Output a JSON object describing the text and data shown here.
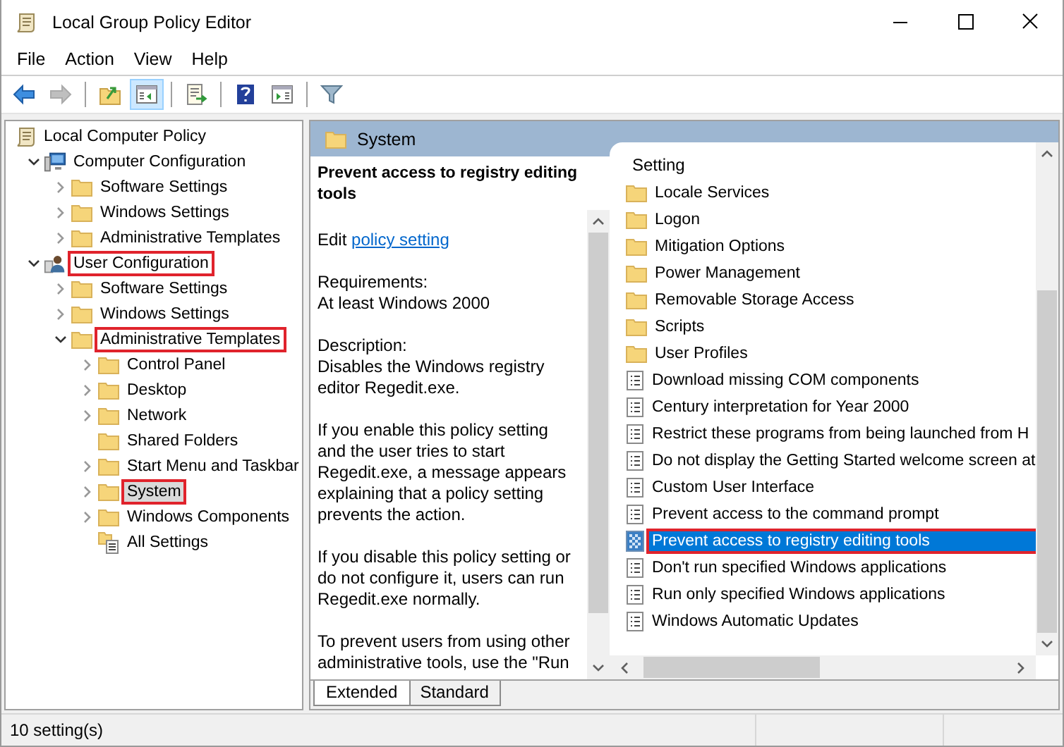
{
  "window": {
    "title": "Local Group Policy Editor"
  },
  "menu": [
    "File",
    "Action",
    "View",
    "Help"
  ],
  "toolbar": [
    {
      "pressed": false,
      "disabled": false
    },
    {
      "pressed": false,
      "disabled": true
    },
    {
      "pressed": false,
      "disabled": false
    },
    {
      "pressed": true,
      "disabled": false
    },
    {
      "pressed": false,
      "disabled": false
    },
    {
      "pressed": false,
      "disabled": false
    },
    {
      "pressed": false,
      "disabled": false
    },
    {
      "pressed": false,
      "disabled": false
    }
  ],
  "tree": [
    {
      "label": "Local Computer Policy",
      "kind": "policy",
      "expandable": false,
      "selected": false,
      "highlighted": false,
      "children": [
        {
          "label": "Computer Configuration",
          "kind": "computer",
          "expandable": true,
          "expanded": true,
          "selected": false,
          "highlighted": false,
          "children": [
            {
              "label": "Software Settings",
              "kind": "folder",
              "expandable": true,
              "expanded": false,
              "selected": false,
              "highlighted": false
            },
            {
              "label": "Windows Settings",
              "kind": "folder",
              "expandable": true,
              "expanded": false,
              "selected": false,
              "highlighted": false
            },
            {
              "label": "Administrative Templates",
              "kind": "folder",
              "expandable": true,
              "expanded": false,
              "selected": false,
              "highlighted": false
            }
          ]
        },
        {
          "label": "User Configuration",
          "kind": "user",
          "expandable": true,
          "expanded": true,
          "selected": false,
          "highlighted": true,
          "children": [
            {
              "label": "Software Settings",
              "kind": "folder",
              "expandable": true,
              "expanded": false,
              "selected": false,
              "highlighted": false
            },
            {
              "label": "Windows Settings",
              "kind": "folder",
              "expandable": true,
              "expanded": false,
              "selected": false,
              "highlighted": false
            },
            {
              "label": "Administrative Templates",
              "kind": "folder",
              "expandable": true,
              "expanded": true,
              "selected": false,
              "highlighted": true,
              "children": [
                {
                  "label": "Control Panel",
                  "kind": "folder",
                  "expandable": true,
                  "expanded": false,
                  "selected": false,
                  "highlighted": false
                },
                {
                  "label": "Desktop",
                  "kind": "folder",
                  "expandable": true,
                  "expanded": false,
                  "selected": false,
                  "highlighted": false
                },
                {
                  "label": "Network",
                  "kind": "folder",
                  "expandable": true,
                  "expanded": false,
                  "selected": false,
                  "highlighted": false
                },
                {
                  "label": "Shared Folders",
                  "kind": "folder",
                  "expandable": false,
                  "expanded": false,
                  "selected": false,
                  "highlighted": false
                },
                {
                  "label": "Start Menu and Taskbar",
                  "kind": "folder",
                  "expandable": true,
                  "expanded": false,
                  "selected": false,
                  "highlighted": false
                },
                {
                  "label": "System",
                  "kind": "folder",
                  "expandable": true,
                  "expanded": false,
                  "selected": true,
                  "highlighted": true
                },
                {
                  "label": "Windows Components",
                  "kind": "folder",
                  "expandable": true,
                  "expanded": false,
                  "selected": false,
                  "highlighted": false
                },
                {
                  "label": "All Settings",
                  "kind": "all-settings",
                  "expandable": false,
                  "expanded": false,
                  "selected": false,
                  "highlighted": false
                }
              ]
            }
          ]
        }
      ]
    }
  ],
  "details": {
    "header": "System",
    "title": "Prevent access to registry editing\ntools",
    "edit_prefix": "Edit",
    "edit_link": "policy setting",
    "paragraphs": [
      "Requirements:\nAt least Windows 2000",
      "Description:\nDisables the Windows registry\neditor Regedit.exe.",
      "If you enable this policy setting\nand the user tries to start\nRegedit.exe, a message appears\nexplaining that a policy setting\nprevents the action.",
      "If you disable this policy setting or\ndo not configure it, users can run\nRegedit.exe normally.",
      "To prevent users from using other\nadministrative tools, use the \"Run"
    ]
  },
  "settings": {
    "column": "Setting",
    "items": [
      {
        "label": "Locale Services",
        "kind": "folder",
        "selected": false,
        "highlighted": false
      },
      {
        "label": "Logon",
        "kind": "folder",
        "selected": false,
        "highlighted": false
      },
      {
        "label": "Mitigation Options",
        "kind": "folder",
        "selected": false,
        "highlighted": false
      },
      {
        "label": "Power Management",
        "kind": "folder",
        "selected": false,
        "highlighted": false
      },
      {
        "label": "Removable Storage Access",
        "kind": "folder",
        "selected": false,
        "highlighted": false
      },
      {
        "label": "Scripts",
        "kind": "folder",
        "selected": false,
        "highlighted": false
      },
      {
        "label": "User Profiles",
        "kind": "folder",
        "selected": false,
        "highlighted": false
      },
      {
        "label": "Download missing COM components",
        "kind": "policy",
        "selected": false,
        "highlighted": false
      },
      {
        "label": "Century interpretation for Year 2000",
        "kind": "policy",
        "selected": false,
        "highlighted": false
      },
      {
        "label": "Restrict these programs from being launched from H",
        "kind": "policy",
        "selected": false,
        "highlighted": false
      },
      {
        "label": "Do not display the Getting Started welcome screen at",
        "kind": "policy",
        "selected": false,
        "highlighted": false
      },
      {
        "label": "Custom User Interface",
        "kind": "policy",
        "selected": false,
        "highlighted": false
      },
      {
        "label": "Prevent access to the command prompt",
        "kind": "policy",
        "selected": false,
        "highlighted": false
      },
      {
        "label": "Prevent access to registry editing tools",
        "kind": "policy",
        "selected": true,
        "highlighted": true
      },
      {
        "label": "Don't run specified Windows applications",
        "kind": "policy",
        "selected": false,
        "highlighted": false
      },
      {
        "label": "Run only specified Windows applications",
        "kind": "policy",
        "selected": false,
        "highlighted": false
      },
      {
        "label": "Windows Automatic Updates",
        "kind": "policy",
        "selected": false,
        "highlighted": false
      }
    ]
  },
  "tabs": [
    {
      "label": "Extended",
      "selected": true
    },
    {
      "label": "Standard",
      "selected": false
    }
  ],
  "status_bar": {
    "text": "10 setting(s)"
  }
}
